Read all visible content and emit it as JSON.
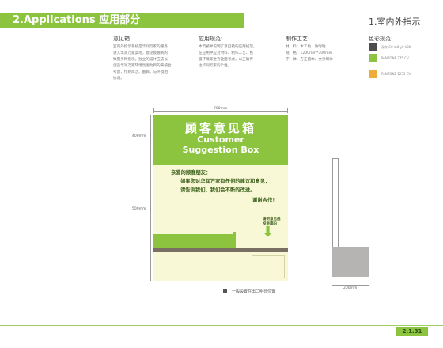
{
  "header": {
    "title": "2.Applications  应用部分",
    "section": "1.室内外指示"
  },
  "columns": {
    "col1": {
      "heading": "意见箱",
      "lines": [
        "室内外指示系统是华润万家的服务",
        "进入华润万家卖场，意见接触到的",
        "致服务种指示。独立的设计应该以",
        "创造华润万家环境氛围为目的来被合",
        "考虑，作到简洁、醒目，与环境相",
        "协调。"
      ]
    },
    "col2": {
      "heading": "应用规范:",
      "lines": [
        "本页被举说明了意见箱的应用规范。",
        "在应用中应对材料、制作工艺、色",
        "度环境等进行全面考虑，以正确传",
        "达华润万家的个性。"
      ]
    },
    "col3": {
      "heading": "制作工艺:",
      "rows": [
        {
          "k": "材　料：",
          "v": "木工板、防时钻"
        },
        {
          "k": "规　格：",
          "v": "1200mm*700mm"
        },
        {
          "k": "字　体：",
          "v": "方正圆体、文泉细体"
        }
      ]
    },
    "col4": {
      "heading": "色彩规范:",
      "swatches": [
        {
          "label": "深灰 C0 m0 y0 k80",
          "color": "#4d4d4d"
        },
        {
          "label": "PANTONE 375 CV",
          "color": "#8cc43f"
        },
        {
          "label": "PANTONE 1233 CV",
          "color": "#f0ac3a"
        }
      ]
    }
  },
  "dimensions": {
    "width_top": "700mm",
    "height_upper": "400mm",
    "height_lower": "500mm",
    "side_width": "200mm"
  },
  "board": {
    "title_zh": "顾客意见箱",
    "title_en_1": "Customer",
    "title_en_2": "Suggestion Box",
    "greeting": "亲爱的顾客朋友：",
    "line1": "如果您对华润万家有任何的建议和意见，",
    "line2": "请告诉我们，我们会不断的改进。",
    "thanks": "谢谢合作！",
    "drop_label_1": "请把意见纸",
    "drop_label_2": "投进箱内",
    "arrow_glyph": "⬇"
  },
  "note": "一般设置在出口明显位置",
  "page_number": "2.1.31"
}
